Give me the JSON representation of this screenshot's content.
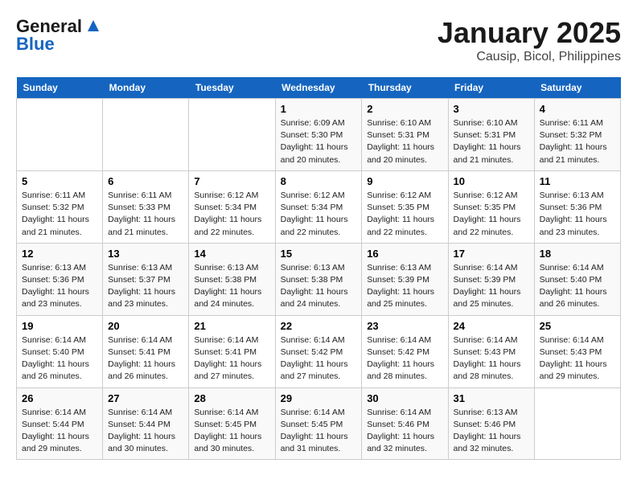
{
  "header": {
    "logo_line1": "General",
    "logo_line2": "Blue",
    "main_title": "January 2025",
    "sub_title": "Causip, Bicol, Philippines"
  },
  "days_of_week": [
    "Sunday",
    "Monday",
    "Tuesday",
    "Wednesday",
    "Thursday",
    "Friday",
    "Saturday"
  ],
  "weeks": [
    [
      {
        "day": "",
        "info": ""
      },
      {
        "day": "",
        "info": ""
      },
      {
        "day": "",
        "info": ""
      },
      {
        "day": "1",
        "info": "Sunrise: 6:09 AM\nSunset: 5:30 PM\nDaylight: 11 hours\nand 20 minutes."
      },
      {
        "day": "2",
        "info": "Sunrise: 6:10 AM\nSunset: 5:31 PM\nDaylight: 11 hours\nand 20 minutes."
      },
      {
        "day": "3",
        "info": "Sunrise: 6:10 AM\nSunset: 5:31 PM\nDaylight: 11 hours\nand 21 minutes."
      },
      {
        "day": "4",
        "info": "Sunrise: 6:11 AM\nSunset: 5:32 PM\nDaylight: 11 hours\nand 21 minutes."
      }
    ],
    [
      {
        "day": "5",
        "info": "Sunrise: 6:11 AM\nSunset: 5:32 PM\nDaylight: 11 hours\nand 21 minutes."
      },
      {
        "day": "6",
        "info": "Sunrise: 6:11 AM\nSunset: 5:33 PM\nDaylight: 11 hours\nand 21 minutes."
      },
      {
        "day": "7",
        "info": "Sunrise: 6:12 AM\nSunset: 5:34 PM\nDaylight: 11 hours\nand 22 minutes."
      },
      {
        "day": "8",
        "info": "Sunrise: 6:12 AM\nSunset: 5:34 PM\nDaylight: 11 hours\nand 22 minutes."
      },
      {
        "day": "9",
        "info": "Sunrise: 6:12 AM\nSunset: 5:35 PM\nDaylight: 11 hours\nand 22 minutes."
      },
      {
        "day": "10",
        "info": "Sunrise: 6:12 AM\nSunset: 5:35 PM\nDaylight: 11 hours\nand 22 minutes."
      },
      {
        "day": "11",
        "info": "Sunrise: 6:13 AM\nSunset: 5:36 PM\nDaylight: 11 hours\nand 23 minutes."
      }
    ],
    [
      {
        "day": "12",
        "info": "Sunrise: 6:13 AM\nSunset: 5:36 PM\nDaylight: 11 hours\nand 23 minutes."
      },
      {
        "day": "13",
        "info": "Sunrise: 6:13 AM\nSunset: 5:37 PM\nDaylight: 11 hours\nand 23 minutes."
      },
      {
        "day": "14",
        "info": "Sunrise: 6:13 AM\nSunset: 5:38 PM\nDaylight: 11 hours\nand 24 minutes."
      },
      {
        "day": "15",
        "info": "Sunrise: 6:13 AM\nSunset: 5:38 PM\nDaylight: 11 hours\nand 24 minutes."
      },
      {
        "day": "16",
        "info": "Sunrise: 6:13 AM\nSunset: 5:39 PM\nDaylight: 11 hours\nand 25 minutes."
      },
      {
        "day": "17",
        "info": "Sunrise: 6:14 AM\nSunset: 5:39 PM\nDaylight: 11 hours\nand 25 minutes."
      },
      {
        "day": "18",
        "info": "Sunrise: 6:14 AM\nSunset: 5:40 PM\nDaylight: 11 hours\nand 26 minutes."
      }
    ],
    [
      {
        "day": "19",
        "info": "Sunrise: 6:14 AM\nSunset: 5:40 PM\nDaylight: 11 hours\nand 26 minutes."
      },
      {
        "day": "20",
        "info": "Sunrise: 6:14 AM\nSunset: 5:41 PM\nDaylight: 11 hours\nand 26 minutes."
      },
      {
        "day": "21",
        "info": "Sunrise: 6:14 AM\nSunset: 5:41 PM\nDaylight: 11 hours\nand 27 minutes."
      },
      {
        "day": "22",
        "info": "Sunrise: 6:14 AM\nSunset: 5:42 PM\nDaylight: 11 hours\nand 27 minutes."
      },
      {
        "day": "23",
        "info": "Sunrise: 6:14 AM\nSunset: 5:42 PM\nDaylight: 11 hours\nand 28 minutes."
      },
      {
        "day": "24",
        "info": "Sunrise: 6:14 AM\nSunset: 5:43 PM\nDaylight: 11 hours\nand 28 minutes."
      },
      {
        "day": "25",
        "info": "Sunrise: 6:14 AM\nSunset: 5:43 PM\nDaylight: 11 hours\nand 29 minutes."
      }
    ],
    [
      {
        "day": "26",
        "info": "Sunrise: 6:14 AM\nSunset: 5:44 PM\nDaylight: 11 hours\nand 29 minutes."
      },
      {
        "day": "27",
        "info": "Sunrise: 6:14 AM\nSunset: 5:44 PM\nDaylight: 11 hours\nand 30 minutes."
      },
      {
        "day": "28",
        "info": "Sunrise: 6:14 AM\nSunset: 5:45 PM\nDaylight: 11 hours\nand 30 minutes."
      },
      {
        "day": "29",
        "info": "Sunrise: 6:14 AM\nSunset: 5:45 PM\nDaylight: 11 hours\nand 31 minutes."
      },
      {
        "day": "30",
        "info": "Sunrise: 6:14 AM\nSunset: 5:46 PM\nDaylight: 11 hours\nand 32 minutes."
      },
      {
        "day": "31",
        "info": "Sunrise: 6:13 AM\nSunset: 5:46 PM\nDaylight: 11 hours\nand 32 minutes."
      },
      {
        "day": "",
        "info": ""
      }
    ]
  ]
}
